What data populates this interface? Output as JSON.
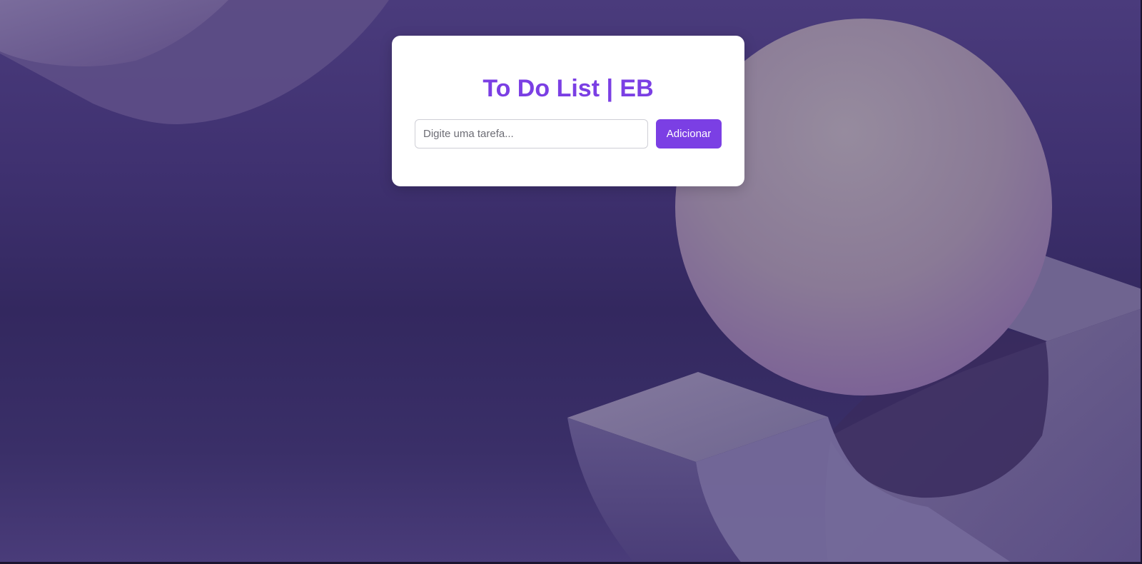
{
  "app": {
    "title": "To Do List | EB"
  },
  "form": {
    "input_placeholder": "Digite uma tarefa...",
    "input_value": "",
    "add_button_label": "Adicionar"
  },
  "colors": {
    "accent": "#7b3fe4",
    "card_background": "#ffffff",
    "page_background": "#3b2e6b"
  }
}
